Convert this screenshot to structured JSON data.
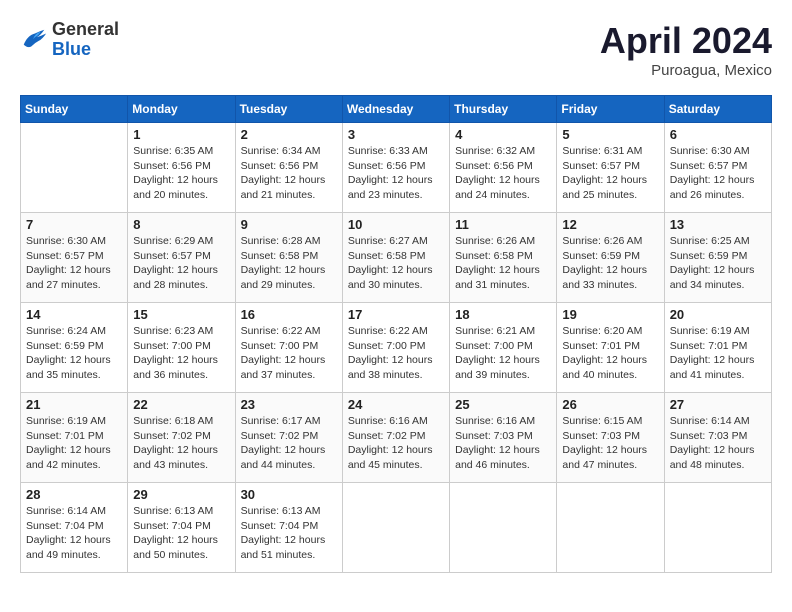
{
  "header": {
    "logo_line1": "General",
    "logo_line2": "Blue",
    "month": "April 2024",
    "location": "Puroagua, Mexico"
  },
  "days_of_week": [
    "Sunday",
    "Monday",
    "Tuesday",
    "Wednesday",
    "Thursday",
    "Friday",
    "Saturday"
  ],
  "weeks": [
    [
      {
        "day": "",
        "info": ""
      },
      {
        "day": "1",
        "info": "Sunrise: 6:35 AM\nSunset: 6:56 PM\nDaylight: 12 hours\nand 20 minutes."
      },
      {
        "day": "2",
        "info": "Sunrise: 6:34 AM\nSunset: 6:56 PM\nDaylight: 12 hours\nand 21 minutes."
      },
      {
        "day": "3",
        "info": "Sunrise: 6:33 AM\nSunset: 6:56 PM\nDaylight: 12 hours\nand 23 minutes."
      },
      {
        "day": "4",
        "info": "Sunrise: 6:32 AM\nSunset: 6:56 PM\nDaylight: 12 hours\nand 24 minutes."
      },
      {
        "day": "5",
        "info": "Sunrise: 6:31 AM\nSunset: 6:57 PM\nDaylight: 12 hours\nand 25 minutes."
      },
      {
        "day": "6",
        "info": "Sunrise: 6:30 AM\nSunset: 6:57 PM\nDaylight: 12 hours\nand 26 minutes."
      }
    ],
    [
      {
        "day": "7",
        "info": "Sunrise: 6:30 AM\nSunset: 6:57 PM\nDaylight: 12 hours\nand 27 minutes."
      },
      {
        "day": "8",
        "info": "Sunrise: 6:29 AM\nSunset: 6:57 PM\nDaylight: 12 hours\nand 28 minutes."
      },
      {
        "day": "9",
        "info": "Sunrise: 6:28 AM\nSunset: 6:58 PM\nDaylight: 12 hours\nand 29 minutes."
      },
      {
        "day": "10",
        "info": "Sunrise: 6:27 AM\nSunset: 6:58 PM\nDaylight: 12 hours\nand 30 minutes."
      },
      {
        "day": "11",
        "info": "Sunrise: 6:26 AM\nSunset: 6:58 PM\nDaylight: 12 hours\nand 31 minutes."
      },
      {
        "day": "12",
        "info": "Sunrise: 6:26 AM\nSunset: 6:59 PM\nDaylight: 12 hours\nand 33 minutes."
      },
      {
        "day": "13",
        "info": "Sunrise: 6:25 AM\nSunset: 6:59 PM\nDaylight: 12 hours\nand 34 minutes."
      }
    ],
    [
      {
        "day": "14",
        "info": "Sunrise: 6:24 AM\nSunset: 6:59 PM\nDaylight: 12 hours\nand 35 minutes."
      },
      {
        "day": "15",
        "info": "Sunrise: 6:23 AM\nSunset: 7:00 PM\nDaylight: 12 hours\nand 36 minutes."
      },
      {
        "day": "16",
        "info": "Sunrise: 6:22 AM\nSunset: 7:00 PM\nDaylight: 12 hours\nand 37 minutes."
      },
      {
        "day": "17",
        "info": "Sunrise: 6:22 AM\nSunset: 7:00 PM\nDaylight: 12 hours\nand 38 minutes."
      },
      {
        "day": "18",
        "info": "Sunrise: 6:21 AM\nSunset: 7:00 PM\nDaylight: 12 hours\nand 39 minutes."
      },
      {
        "day": "19",
        "info": "Sunrise: 6:20 AM\nSunset: 7:01 PM\nDaylight: 12 hours\nand 40 minutes."
      },
      {
        "day": "20",
        "info": "Sunrise: 6:19 AM\nSunset: 7:01 PM\nDaylight: 12 hours\nand 41 minutes."
      }
    ],
    [
      {
        "day": "21",
        "info": "Sunrise: 6:19 AM\nSunset: 7:01 PM\nDaylight: 12 hours\nand 42 minutes."
      },
      {
        "day": "22",
        "info": "Sunrise: 6:18 AM\nSunset: 7:02 PM\nDaylight: 12 hours\nand 43 minutes."
      },
      {
        "day": "23",
        "info": "Sunrise: 6:17 AM\nSunset: 7:02 PM\nDaylight: 12 hours\nand 44 minutes."
      },
      {
        "day": "24",
        "info": "Sunrise: 6:16 AM\nSunset: 7:02 PM\nDaylight: 12 hours\nand 45 minutes."
      },
      {
        "day": "25",
        "info": "Sunrise: 6:16 AM\nSunset: 7:03 PM\nDaylight: 12 hours\nand 46 minutes."
      },
      {
        "day": "26",
        "info": "Sunrise: 6:15 AM\nSunset: 7:03 PM\nDaylight: 12 hours\nand 47 minutes."
      },
      {
        "day": "27",
        "info": "Sunrise: 6:14 AM\nSunset: 7:03 PM\nDaylight: 12 hours\nand 48 minutes."
      }
    ],
    [
      {
        "day": "28",
        "info": "Sunrise: 6:14 AM\nSunset: 7:04 PM\nDaylight: 12 hours\nand 49 minutes."
      },
      {
        "day": "29",
        "info": "Sunrise: 6:13 AM\nSunset: 7:04 PM\nDaylight: 12 hours\nand 50 minutes."
      },
      {
        "day": "30",
        "info": "Sunrise: 6:13 AM\nSunset: 7:04 PM\nDaylight: 12 hours\nand 51 minutes."
      },
      {
        "day": "",
        "info": ""
      },
      {
        "day": "",
        "info": ""
      },
      {
        "day": "",
        "info": ""
      },
      {
        "day": "",
        "info": ""
      }
    ]
  ]
}
